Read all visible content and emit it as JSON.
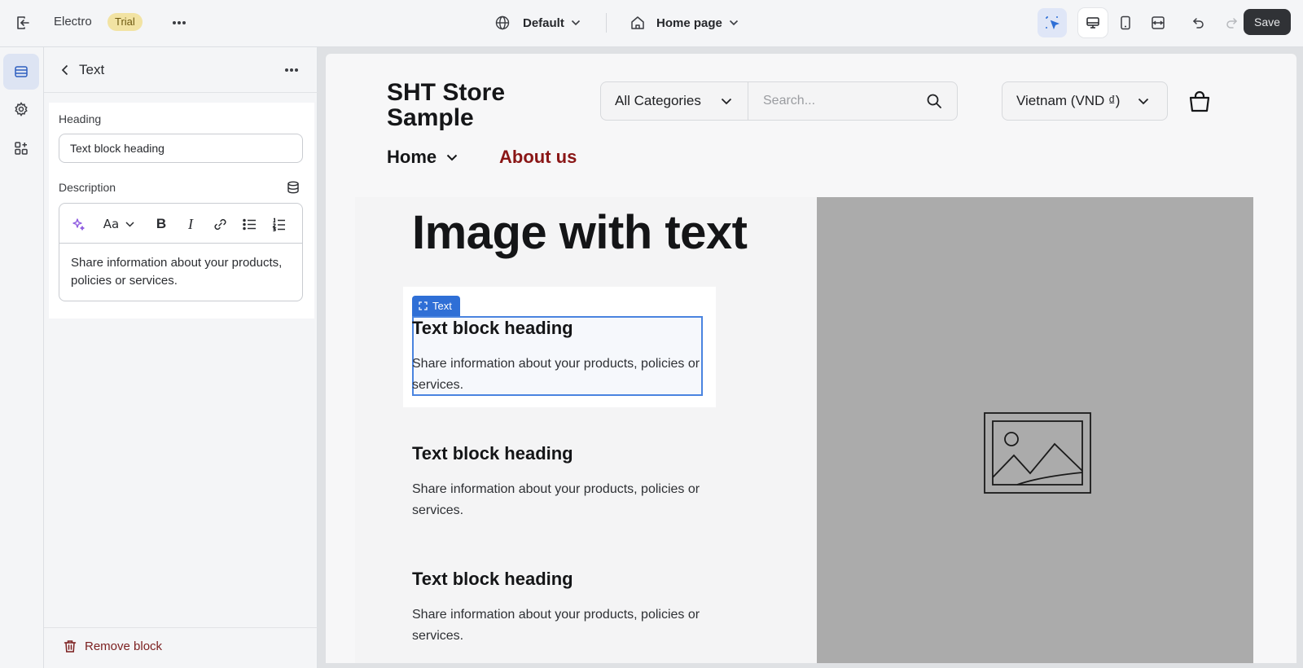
{
  "topbar": {
    "app_name": "Electro",
    "badge": "Trial",
    "theme": "Default",
    "page": "Home page",
    "save_label": "Save",
    "tools": [
      "select-cursor-icon",
      "desktop-icon",
      "mobile-icon",
      "fullwidth-icon",
      "undo-icon",
      "redo-icon"
    ]
  },
  "rail": {
    "items": [
      "sections-icon",
      "settings-icon",
      "apps-icon"
    ],
    "active": "sections-icon"
  },
  "panel": {
    "title": "Text",
    "heading_label": "Heading",
    "heading_value": "Text block heading",
    "description_label": "Description",
    "description_value": "Share information about your products, policies or services.",
    "remove_label": "Remove block"
  },
  "site": {
    "store_name": "SHT Store Sample",
    "category_select": "All Categories",
    "search_placeholder": "Search...",
    "currency": "Vietnam (VND ₫)",
    "nav": {
      "home": "Home",
      "about": "About us"
    },
    "section_title": "Image with text",
    "selection_tag": "Text",
    "blocks": [
      {
        "heading": "Text block heading",
        "text": "Share information about your products, policies or services."
      },
      {
        "heading": "Text block heading",
        "text": "Share information about your products, policies or services."
      },
      {
        "heading": "Text block heading",
        "text": "Share information about your products, policies or services."
      }
    ]
  },
  "colors": {
    "accent_blue": "#2f6fd6",
    "danger": "#7b1f1f",
    "about_link": "#8a1616",
    "save_button": "#303236"
  }
}
